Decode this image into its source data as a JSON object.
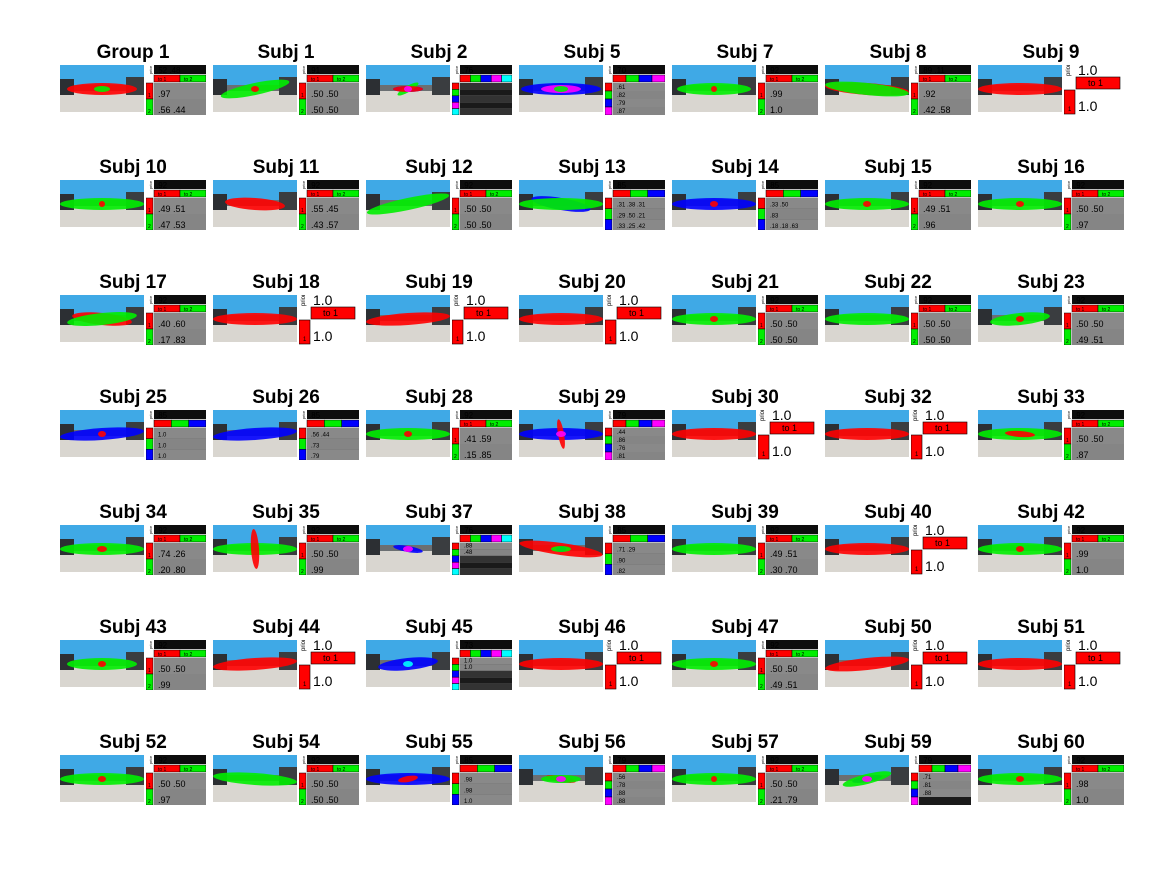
{
  "panels": [
    {
      "title": "Group 1",
      "k": 2,
      "prior": ".52 .48",
      "rows": [
        ".97",
        ".56 .44"
      ],
      "blobs": [
        {
          "c": "red",
          "rot": 0,
          "w": 70
        },
        {
          "c": "green",
          "rot": 0,
          "w": 16
        }
      ]
    },
    {
      "title": "Subj 1",
      "k": 2,
      "prior": ".91",
      "rows": [
        ".50 .50",
        ".50 .50"
      ],
      "blobs": [
        {
          "c": "green",
          "rot": -12,
          "w": 70
        },
        {
          "c": "red",
          "rot": 0,
          "w": 8
        }
      ]
    },
    {
      "title": "Subj 2",
      "k": 5,
      "prior": ".76",
      "rows": [],
      "blobs": [
        {
          "c": "blue",
          "rot": 0,
          "w": 30
        },
        {
          "c": "green",
          "rot": -30,
          "w": 24
        },
        {
          "c": "red",
          "rot": 0,
          "w": 30
        },
        {
          "c": "magenta",
          "rot": 0,
          "w": 8
        }
      ]
    },
    {
      "title": "Subj 5",
      "k": 4,
      "prior": ".70",
      "rows": [
        ".61",
        ".82",
        ".79",
        ".87"
      ],
      "blobs": [
        {
          "c": "blue",
          "rot": 0,
          "w": 80
        },
        {
          "c": "magenta",
          "rot": 0,
          "w": 40
        },
        {
          "c": "green",
          "rot": 0,
          "w": 14
        }
      ]
    },
    {
      "title": "Subj 7",
      "k": 2,
      "prior": ".92",
      "rows": [
        ".99",
        "1.0"
      ],
      "blobs": [
        {
          "c": "green",
          "rot": 0,
          "w": 74
        },
        {
          "c": "red",
          "rot": 0,
          "w": 6
        }
      ]
    },
    {
      "title": "Subj 8",
      "k": 2,
      "prior": ".89 .11",
      "rows": [
        ".92",
        ".42 .58"
      ],
      "blobs": [
        {
          "c": "red",
          "rot": 4,
          "w": 84
        },
        {
          "c": "green",
          "rot": 6,
          "w": 84
        }
      ]
    },
    {
      "title": "Subj 9",
      "k": 1,
      "prior": "1.0",
      "rows": [
        "1.0"
      ],
      "blobs": [
        {
          "c": "red",
          "rot": 0,
          "w": 84
        }
      ]
    },
    {
      "title": "Subj 10",
      "k": 2,
      "prior": ".92",
      "rows": [
        ".49 .51",
        ".47 .53"
      ],
      "blobs": [
        {
          "c": "green",
          "rot": 0,
          "w": 84
        },
        {
          "c": "red",
          "rot": 0,
          "w": 6
        }
      ]
    },
    {
      "title": "Subj 11",
      "k": 2,
      "prior": ".92",
      "rows": [
        ".55 .45",
        ".43 .57"
      ],
      "blobs": [
        {
          "c": "red",
          "rot": 4,
          "w": 60
        }
      ]
    },
    {
      "title": "Subj 12",
      "k": 2,
      "prior": ".92",
      "rows": [
        ".50 .50",
        ".50 .50"
      ],
      "blobs": [
        {
          "c": "green",
          "rot": -12,
          "w": 84
        }
      ]
    },
    {
      "title": "Subj 13",
      "k": 3,
      "prior": ".85",
      "rows": [
        ".31 .38 .31",
        ".29 .50 .21",
        ".33 .25 .42"
      ],
      "blobs": [
        {
          "c": "blue",
          "rot": 10,
          "w": 60
        },
        {
          "c": "green",
          "rot": 0,
          "w": 84
        }
      ]
    },
    {
      "title": "Subj 14",
      "k": 3,
      "prior": ".85",
      "rows": [
        ".33 .50",
        ".83",
        ".18 .18 .63"
      ],
      "blobs": [
        {
          "c": "blue",
          "rot": 0,
          "w": 84
        },
        {
          "c": "red",
          "rot": 0,
          "w": 8
        }
      ]
    },
    {
      "title": "Subj 15",
      "k": 2,
      "prior": ".92",
      "rows": [
        ".49 .51",
        ".96"
      ],
      "blobs": [
        {
          "c": "green",
          "rot": 0,
          "w": 84
        },
        {
          "c": "red",
          "rot": 0,
          "w": 8
        }
      ]
    },
    {
      "title": "Subj 16",
      "k": 2,
      "prior": ".92",
      "rows": [
        ".50 .50",
        ".97"
      ],
      "blobs": [
        {
          "c": "green",
          "rot": 0,
          "w": 84
        },
        {
          "c": "red",
          "rot": 0,
          "w": 8
        }
      ]
    },
    {
      "title": "Subj 17",
      "k": 2,
      "prior": ".92",
      "rows": [
        ".40 .60",
        ".17 .83"
      ],
      "blobs": [
        {
          "c": "red",
          "rot": 6,
          "w": 60
        },
        {
          "c": "green",
          "rot": -6,
          "w": 70
        }
      ]
    },
    {
      "title": "Subj 18",
      "k": 1,
      "prior": "1.0",
      "rows": [
        "1.0"
      ],
      "blobs": [
        {
          "c": "red",
          "rot": 0,
          "w": 84
        }
      ]
    },
    {
      "title": "Subj 19",
      "k": 1,
      "prior": "1.0",
      "rows": [
        "1.0"
      ],
      "blobs": [
        {
          "c": "red",
          "rot": -4,
          "w": 84
        }
      ]
    },
    {
      "title": "Subj 20",
      "k": 1,
      "prior": "1.0",
      "rows": [
        "1.0"
      ],
      "blobs": [
        {
          "c": "red",
          "rot": 0,
          "w": 84
        }
      ]
    },
    {
      "title": "Subj 21",
      "k": 2,
      "prior": ".92",
      "rows": [
        ".50 .50",
        ".50 .50"
      ],
      "blobs": [
        {
          "c": "green",
          "rot": 0,
          "w": 84
        },
        {
          "c": "red",
          "rot": 0,
          "w": 8
        }
      ]
    },
    {
      "title": "Subj 22",
      "k": 2,
      "prior": ".92",
      "rows": [
        ".50 .50",
        ".50 .50"
      ],
      "blobs": [
        {
          "c": "green",
          "rot": 0,
          "w": 84
        }
      ]
    },
    {
      "title": "Subj 23",
      "k": 2,
      "prior": ".92",
      "rows": [
        ".50 .50",
        ".49 .51"
      ],
      "blobs": [
        {
          "c": "green",
          "rot": -6,
          "w": 60
        },
        {
          "c": "red",
          "rot": 0,
          "w": 8
        }
      ]
    },
    {
      "title": "Subj 25",
      "k": 3,
      "prior": ".85",
      "rows": [
        "1.0",
        "1.0",
        "1.0"
      ],
      "blobs": [
        {
          "c": "blue",
          "rot": -4,
          "w": 84
        },
        {
          "c": "red",
          "rot": 0,
          "w": 8
        }
      ]
    },
    {
      "title": "Subj 26",
      "k": 3,
      "prior": ".85",
      "rows": [
        ".56 .44",
        ".73",
        ".79"
      ],
      "blobs": [
        {
          "c": "blue",
          "rot": -4,
          "w": 84
        }
      ]
    },
    {
      "title": "Subj 28",
      "k": 2,
      "prior": ".92",
      "rows": [
        ".41 .59",
        ".15 .85"
      ],
      "blobs": [
        {
          "c": "green",
          "rot": 0,
          "w": 84
        },
        {
          "c": "red",
          "rot": 0,
          "w": 8
        }
      ]
    },
    {
      "title": "Subj 29",
      "k": 4,
      "prior": ".79",
      "rows": [
        ".44",
        ".86",
        ".76",
        ".81"
      ],
      "blobs": [
        {
          "c": "blue",
          "rot": 0,
          "w": 84
        },
        {
          "c": "red",
          "rot": 80,
          "w": 30
        },
        {
          "c": "magenta",
          "rot": 0,
          "w": 10
        }
      ]
    },
    {
      "title": "Subj 30",
      "k": 1,
      "prior": "1.0",
      "rows": [
        "1.0"
      ],
      "blobs": [
        {
          "c": "red",
          "rot": 0,
          "w": 84
        }
      ]
    },
    {
      "title": "Subj 32",
      "k": 1,
      "prior": "1.0",
      "rows": [
        "1.0"
      ],
      "blobs": [
        {
          "c": "red",
          "rot": 0,
          "w": 84
        }
      ]
    },
    {
      "title": "Subj 33",
      "k": 2,
      "prior": ".92",
      "rows": [
        ".50 .50",
        ".87"
      ],
      "blobs": [
        {
          "c": "green",
          "rot": 0,
          "w": 84
        },
        {
          "c": "red",
          "rot": 4,
          "w": 30
        }
      ]
    },
    {
      "title": "Subj 34",
      "k": 2,
      "prior": ".92",
      "rows": [
        ".74 .26",
        ".20 .80"
      ],
      "blobs": [
        {
          "c": "green",
          "rot": 0,
          "w": 84
        },
        {
          "c": "red",
          "rot": 0,
          "w": 10
        }
      ]
    },
    {
      "title": "Subj 35",
      "k": 2,
      "prior": ".92",
      "rows": [
        ".50 .50",
        ".99"
      ],
      "blobs": [
        {
          "c": "green",
          "rot": 0,
          "w": 84
        },
        {
          "c": "red",
          "rot": 86,
          "w": 40
        }
      ]
    },
    {
      "title": "Subj 37",
      "k": 5,
      "prior": ".76",
      "rows": [
        ".88",
        ".48"
      ],
      "blobs": [
        {
          "c": "blue",
          "rot": 10,
          "w": 30
        },
        {
          "c": "magenta",
          "rot": 0,
          "w": 10
        }
      ]
    },
    {
      "title": "Subj 38",
      "k": 3,
      "prior": ".85",
      "rows": [
        ".71 .29",
        ".90",
        ".82"
      ],
      "blobs": [
        {
          "c": "red",
          "rot": 8,
          "w": 84
        },
        {
          "c": "blue",
          "rot": 0,
          "w": 10
        },
        {
          "c": "green",
          "rot": 0,
          "w": 20
        }
      ]
    },
    {
      "title": "Subj 39",
      "k": 2,
      "prior": ".92",
      "rows": [
        ".49 .51",
        ".30 .70"
      ],
      "blobs": [
        {
          "c": "green",
          "rot": 0,
          "w": 84
        }
      ]
    },
    {
      "title": "Subj 40",
      "k": 1,
      "prior": "1.0",
      "rows": [
        "1.0"
      ],
      "blobs": [
        {
          "c": "red",
          "rot": 0,
          "w": 84
        }
      ]
    },
    {
      "title": "Subj 42",
      "k": 2,
      "prior": ".92",
      "rows": [
        ".99",
        "1.0"
      ],
      "blobs": [
        {
          "c": "green",
          "rot": 0,
          "w": 84
        },
        {
          "c": "red",
          "rot": 0,
          "w": 8
        }
      ]
    },
    {
      "title": "Subj 43",
      "k": 2,
      "prior": ".92",
      "rows": [
        ".50 .50",
        ".99"
      ],
      "blobs": [
        {
          "c": "green",
          "rot": 0,
          "w": 70
        },
        {
          "c": "red",
          "rot": 0,
          "w": 8
        }
      ]
    },
    {
      "title": "Subj 44",
      "k": 1,
      "prior": "1.0",
      "rows": [
        "1.0"
      ],
      "blobs": [
        {
          "c": "red",
          "rot": -4,
          "w": 84
        }
      ]
    },
    {
      "title": "Subj 45",
      "k": 5,
      "prior": ".73",
      "rows": [
        "1.0",
        "1.0"
      ],
      "blobs": [
        {
          "c": "blue",
          "rot": -6,
          "w": 60
        },
        {
          "c": "cyan",
          "rot": 0,
          "w": 10
        }
      ]
    },
    {
      "title": "Subj 46",
      "k": 1,
      "prior": "1.0",
      "rows": [
        "1.0"
      ],
      "blobs": [
        {
          "c": "red",
          "rot": 0,
          "w": 84
        }
      ]
    },
    {
      "title": "Subj 47",
      "k": 2,
      "prior": ".92",
      "rows": [
        ".50 .50",
        ".49 .51"
      ],
      "blobs": [
        {
          "c": "green",
          "rot": 0,
          "w": 84
        },
        {
          "c": "red",
          "rot": 0,
          "w": 8
        }
      ]
    },
    {
      "title": "Subj 50",
      "k": 1,
      "prior": "1.0",
      "rows": [
        "1.0"
      ],
      "blobs": [
        {
          "c": "red",
          "rot": -6,
          "w": 84
        }
      ]
    },
    {
      "title": "Subj 51",
      "k": 1,
      "prior": "1.0",
      "rows": [
        "1.0"
      ],
      "blobs": [
        {
          "c": "red",
          "rot": 0,
          "w": 84
        }
      ]
    },
    {
      "title": "Subj 52",
      "k": 2,
      "prior": ".92",
      "rows": [
        ".50 .50",
        ".97"
      ],
      "blobs": [
        {
          "c": "green",
          "rot": 0,
          "w": 84
        },
        {
          "c": "red",
          "rot": 0,
          "w": 8
        }
      ]
    },
    {
      "title": "Subj 54",
      "k": 2,
      "prior": ".92",
      "rows": [
        ".50 .50",
        ".50 .50"
      ],
      "blobs": [
        {
          "c": "green",
          "rot": 4,
          "w": 84
        }
      ]
    },
    {
      "title": "Subj 55",
      "k": 3,
      "prior": ".85",
      "rows": [
        ".98",
        ".98",
        "1.0"
      ],
      "blobs": [
        {
          "c": "blue",
          "rot": 0,
          "w": 84
        },
        {
          "c": "red",
          "rot": -10,
          "w": 20
        }
      ]
    },
    {
      "title": "Subj 56",
      "k": 4,
      "prior": ".79",
      "rows": [
        ".56",
        ".78",
        ".88",
        ".88"
      ],
      "blobs": [
        {
          "c": "red",
          "rot": 10,
          "w": 30
        },
        {
          "c": "blue",
          "rot": 0,
          "w": 10
        },
        {
          "c": "green",
          "rot": 0,
          "w": 40
        },
        {
          "c": "magenta",
          "rot": 0,
          "w": 10
        }
      ]
    },
    {
      "title": "Subj 57",
      "k": 2,
      "prior": ".92",
      "rows": [
        ".50 .50",
        ".21 .79"
      ],
      "blobs": [
        {
          "c": "green",
          "rot": 0,
          "w": 84
        },
        {
          "c": "red",
          "rot": 0,
          "w": 6
        }
      ]
    },
    {
      "title": "Subj 59",
      "k": 4,
      "prior": ".79",
      "rows": [
        ".71",
        ".81",
        ".88"
      ],
      "blobs": [
        {
          "c": "blue",
          "rot": -10,
          "w": 30
        },
        {
          "c": "green",
          "rot": -14,
          "w": 50
        },
        {
          "c": "magenta",
          "rot": 0,
          "w": 10
        }
      ]
    },
    {
      "title": "Subj 60",
      "k": 2,
      "prior": ".92",
      "rows": [
        ".98",
        "1.0"
      ],
      "blobs": [
        {
          "c": "green",
          "rot": 0,
          "w": 84
        },
        {
          "c": "red",
          "rot": 0,
          "w": 8
        }
      ]
    }
  ],
  "labels": {
    "prior": "prior",
    "to1": "to 1",
    "to2": "to 2",
    "idx1": "1",
    "idx2": "2"
  },
  "colors": {
    "red": "#ff0000",
    "green": "#00ee00",
    "blue": "#0000ff",
    "magenta": "#ff00ff",
    "cyan": "#00ffff"
  }
}
